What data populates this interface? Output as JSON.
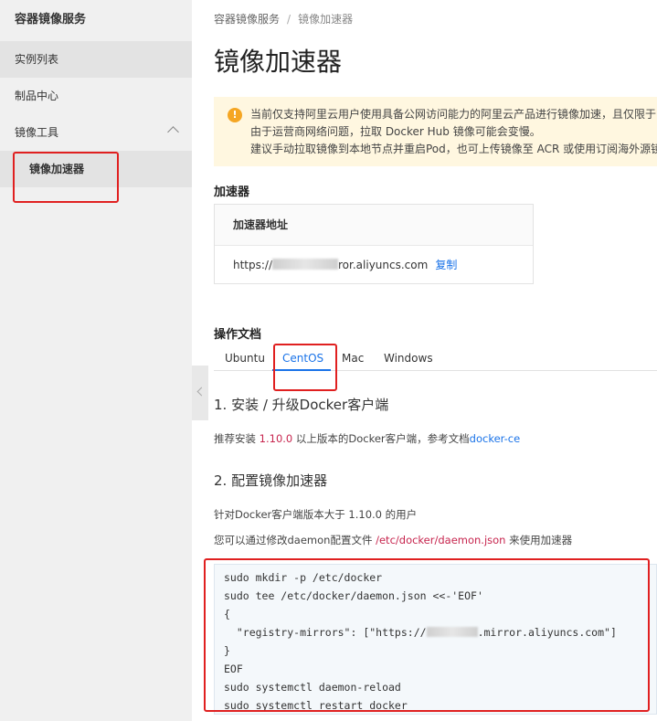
{
  "sidebar": {
    "title": "容器镜像服务",
    "items": [
      {
        "label": "实例列表"
      },
      {
        "label": "制品中心"
      },
      {
        "label": "镜像工具"
      },
      {
        "label": "镜像加速器"
      }
    ]
  },
  "breadcrumb": {
    "root": "容器镜像服务",
    "separator": "/",
    "current": "镜像加速器"
  },
  "page_title": "镜像加速器",
  "notice": {
    "icon": "warning-icon",
    "lines": [
      "当前仅支持阿里云用户使用具备公网访问能力的阿里云产品进行镜像加速，且仅限于",
      "由于运营商网络问题，拉取 Docker Hub 镜像可能会变慢。",
      "建议手动拉取镜像到本地节点并重启Pod，也可上传镜像至 ACR 或使用订阅海外源镜"
    ]
  },
  "accelerator": {
    "section_label": "加速器",
    "header": "加速器地址",
    "url_prefix": "https://",
    "url_suffix": "ror.aliyuncs.com",
    "copy_label": "复制"
  },
  "docs": {
    "section_label": "操作文档",
    "tabs": [
      {
        "label": "Ubuntu"
      },
      {
        "label": "CentOS"
      },
      {
        "label": "Mac"
      },
      {
        "label": "Windows"
      }
    ],
    "active_tab": "CentOS",
    "step1_title": "1. 安装 / 升级Docker客户端",
    "step1_text_a": "推荐安装 ",
    "step1_version": "1.10.0",
    "step1_text_b": " 以上版本的Docker客户端，参考文档",
    "step1_link": "docker-ce",
    "step2_title": "2. 配置镜像加速器",
    "step2_line1": "针对Docker客户端版本大于 1.10.0 的用户",
    "step2_line2_a": "您可以通过修改daemon配置文件 ",
    "step2_line2_path": "/etc/docker/daemon.json",
    "step2_line2_b": " 来使用加速器"
  },
  "code": {
    "line1": "sudo mkdir -p /etc/docker",
    "line2": "sudo tee /etc/docker/daemon.json <<-'EOF'",
    "line3": "{",
    "line4_a": "  \"registry-mirrors\": [\"https://",
    "line4_b": ".mirror.aliyuncs.com\"]",
    "line5": "}",
    "line6": "EOF",
    "line7": "sudo systemctl daemon-reload",
    "line8": "sudo systemctl restart docker"
  },
  "colors": {
    "accent": "#1a73e8",
    "annotation": "#e02020",
    "notice_bg": "#fff7e0",
    "warning": "#f5a623"
  }
}
